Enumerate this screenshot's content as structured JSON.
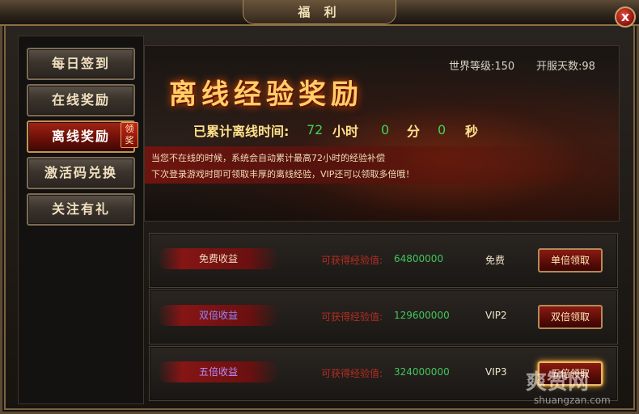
{
  "window": {
    "title": "福 利",
    "close_glyph": "x"
  },
  "sidebar": {
    "items": [
      {
        "label": "每日签到",
        "active": false
      },
      {
        "label": "在线奖励",
        "active": false
      },
      {
        "label": "离线奖励",
        "active": true
      },
      {
        "label": "激活码兑换",
        "active": false
      },
      {
        "label": "关注有礼",
        "active": false
      }
    ],
    "claim_tag": "领奖"
  },
  "banner": {
    "title": "离线经验奖励",
    "world_level": "世界等级:150",
    "server_days": "开服天数:98",
    "accumulated_label": "已累计离线时间:",
    "hours": "72",
    "hours_unit": "小时",
    "minutes": "0",
    "minutes_unit": "分",
    "seconds": "0",
    "seconds_unit": "秒",
    "notice_lines": [
      "当您不在线的时候，系统会自动累计最高72小时的经验补偿",
      "下次登录游戏时即可领取丰厚的离线经验，VIP还可以领取多倍哦！"
    ]
  },
  "rows": [
    {
      "name": "免费收益",
      "label": "可获得经验值:",
      "value": "64800000",
      "tier": "免费",
      "button": "单倍领取"
    },
    {
      "name": "双倍收益",
      "label": "可获得经验值:",
      "value": "129600000",
      "tier": "VIP2",
      "button": "双倍领取"
    },
    {
      "name": "五倍收益",
      "label": "可获得经验值:",
      "value": "324000000",
      "tier": "VIP3",
      "button": "五倍领取"
    }
  ],
  "watermark": {
    "text": "爽赞网",
    "url": "shuangzan.com"
  },
  "colors": {
    "accent_red": "#a42414",
    "value_green": "#41c75c",
    "title_gold": "#ffcf6a",
    "row_name_free": "#f2dcc0",
    "row_name_double": "#8f86ff",
    "row_name_five": "#b98cff"
  }
}
